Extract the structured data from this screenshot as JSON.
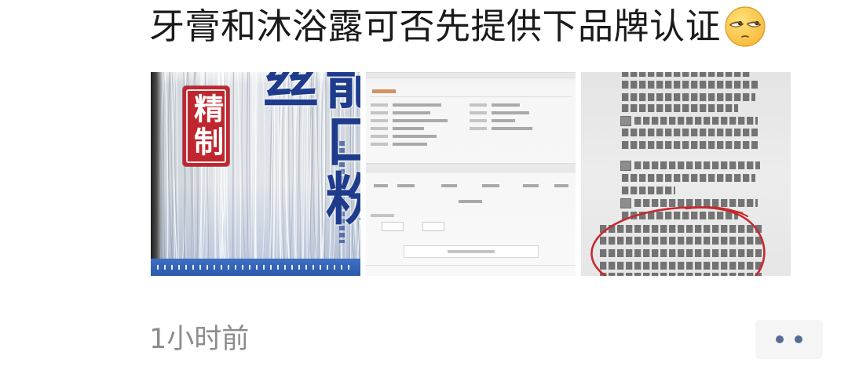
{
  "post": {
    "caption": "牙膏和沐浴露可否先提供下品牌认证",
    "caption_emoji": "eye-roll-emoji-icon",
    "photo_1": {
      "stamp_text": "精制",
      "package_text": "龍口粉丝"
    },
    "timestamp": "1小时前",
    "more_button_icon": "more-dots-icon"
  },
  "colors": {
    "caption_text": "#1a1a1a",
    "timestamp_text": "#8c8c8c",
    "more_dots": "#576b95",
    "more_button_bg": "#f5f5f5",
    "stamp_red": "#c0262d",
    "package_ink_blue": "#1f3c8c",
    "annotation_red": "#c42a2f"
  }
}
